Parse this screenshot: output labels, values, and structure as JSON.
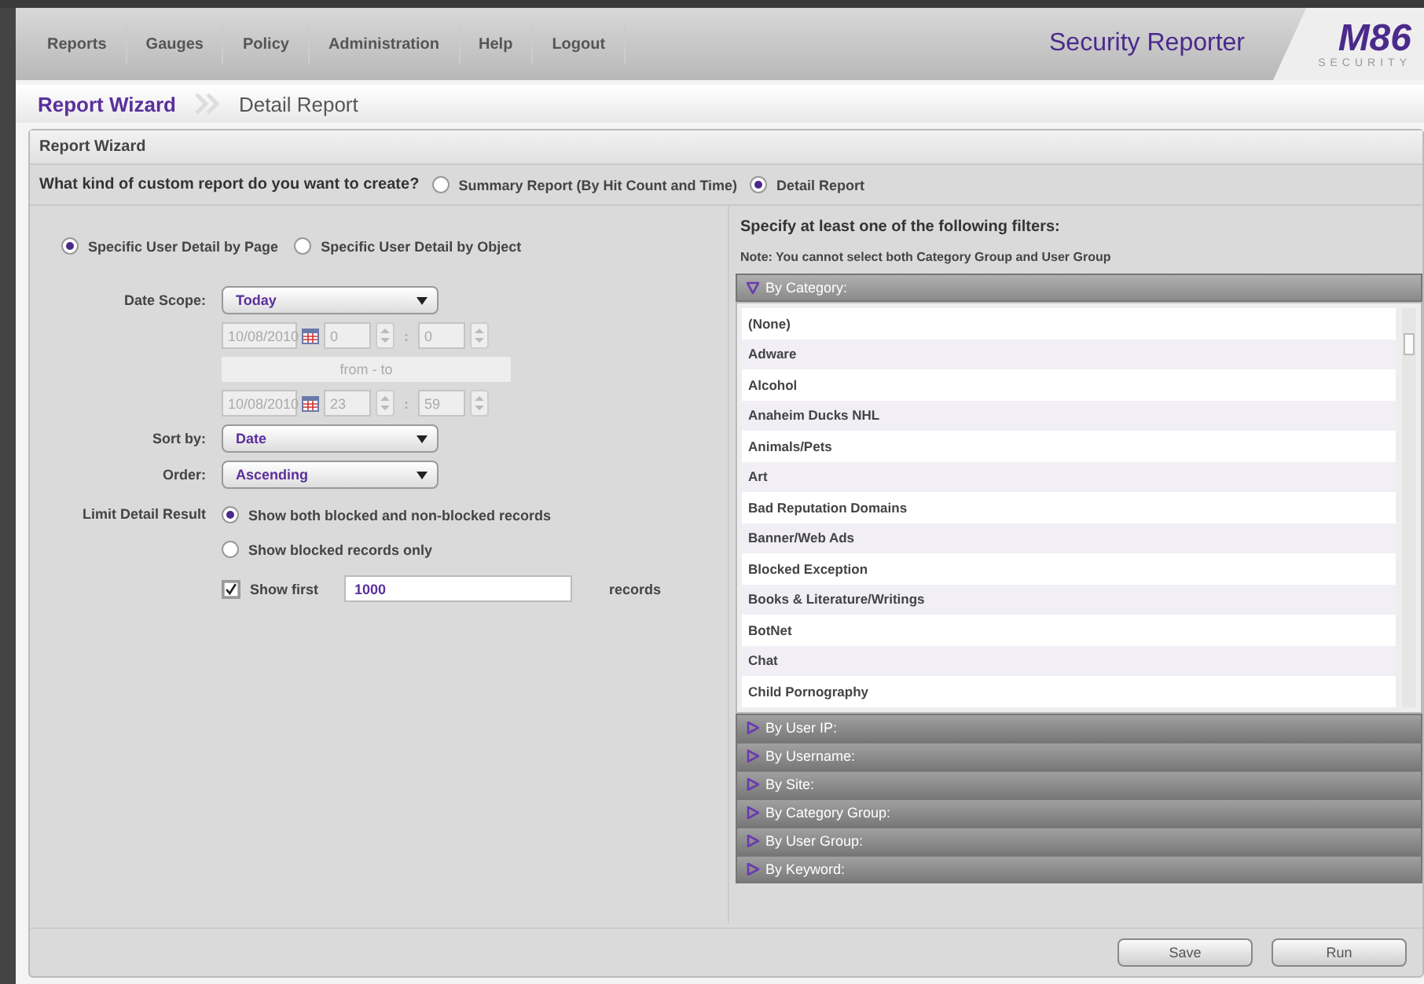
{
  "nav": {
    "items": [
      {
        "label": "Reports"
      },
      {
        "label": "Gauges"
      },
      {
        "label": "Policy"
      },
      {
        "label": "Administration"
      },
      {
        "label": "Help"
      },
      {
        "label": "Logout"
      }
    ],
    "app_title": "Security Reporter",
    "logo": {
      "mark": "M86",
      "sub": "SECURITY"
    }
  },
  "breadcrumb": [
    {
      "label": "Report Wizard",
      "selected": true
    },
    {
      "label": "Detail Report",
      "selected": false
    }
  ],
  "panel_title": "Report Wizard",
  "report_type": {
    "question": "What kind of custom report do you want to create?",
    "options": [
      {
        "label": "Summary Report (By Hit Count and Time)",
        "selected": false
      },
      {
        "label": "Detail Report",
        "selected": true
      }
    ]
  },
  "detail_type": [
    {
      "label": "Specific User Detail by Page",
      "selected": true
    },
    {
      "label": "Specific User Detail by Object",
      "selected": false
    }
  ],
  "date_scope": {
    "label": "Date Scope:",
    "value": "Today"
  },
  "from": {
    "date": "10/08/2010",
    "hour": "0",
    "separator": ":",
    "minute": "0",
    "disabled": true
  },
  "range_label": "from - to",
  "to": {
    "date": "10/08/2010",
    "hour": "23",
    "separator": ":",
    "minute": "59",
    "disabled": true
  },
  "sort_by": {
    "label": "Sort by:",
    "value": "Date"
  },
  "order": {
    "label": "Order:",
    "value": "Ascending"
  },
  "limit": {
    "label": "Limit Detail Result",
    "options": [
      {
        "label": "Show both blocked and non-blocked records",
        "selected": true
      },
      {
        "label": "Show blocked records only",
        "selected": false
      }
    ],
    "show_first": {
      "label": "Show first",
      "checked": true,
      "value": "1000",
      "suffix": "records"
    }
  },
  "filters": {
    "heading": "Specify at least one of the following filters:",
    "note": "Note: You cannot select both Category Group and User Group",
    "sections": [
      {
        "label": "By Category:",
        "expanded": true,
        "items": [
          "(None)",
          "Adware",
          "Alcohol",
          "Anaheim Ducks NHL",
          "Animals/Pets",
          "Art",
          "Bad Reputation Domains",
          "Banner/Web Ads",
          "Blocked Exception",
          "Books & Literature/Writings",
          "BotNet",
          "Chat",
          "Child Pornography"
        ]
      },
      {
        "label": "By User IP:",
        "expanded": false
      },
      {
        "label": "By Username:",
        "expanded": false
      },
      {
        "label": "By Site:",
        "expanded": false
      },
      {
        "label": "By Category Group:",
        "expanded": false
      },
      {
        "label": "By User Group:",
        "expanded": false
      },
      {
        "label": "By Keyword:",
        "expanded": false
      }
    ]
  },
  "buttons": [
    "Save",
    "Run"
  ]
}
